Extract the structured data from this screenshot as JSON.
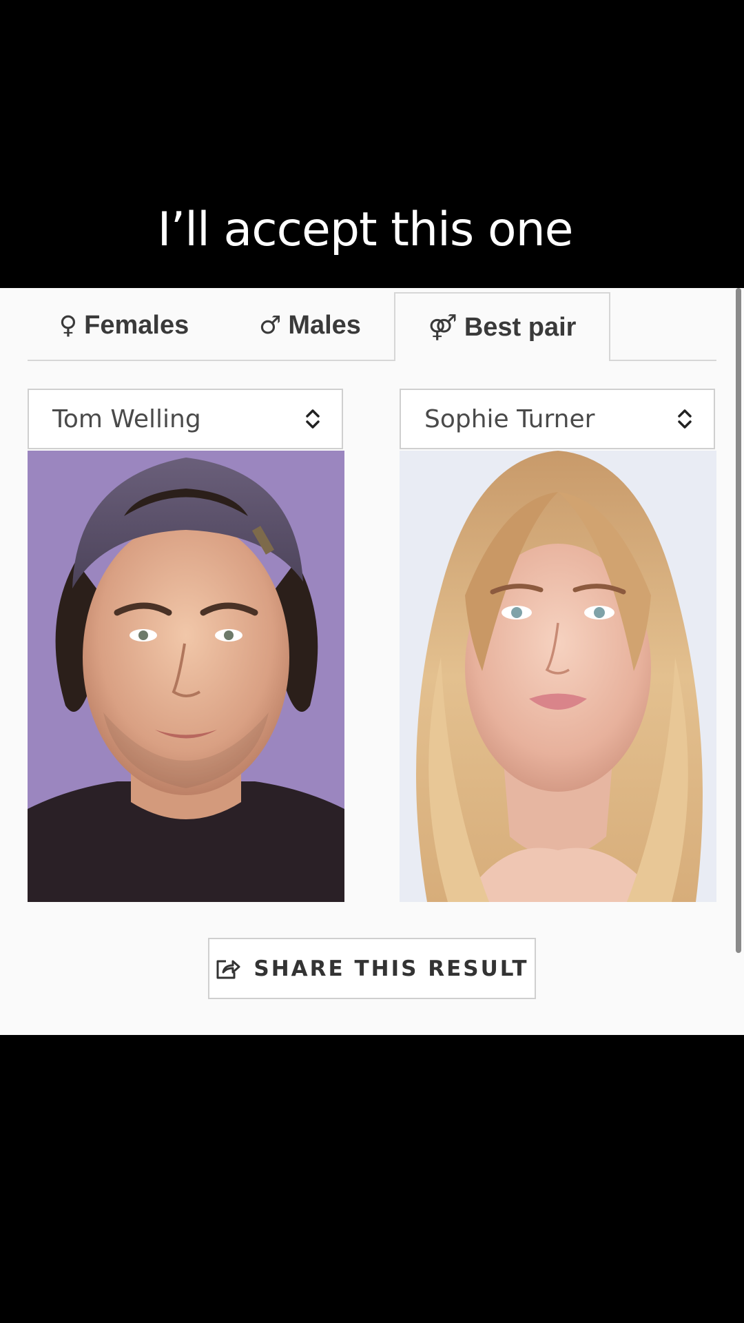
{
  "caption": "I’ll accept this one",
  "tabs": [
    {
      "glyph": "♀",
      "label": "Females",
      "icon": "female-symbol-icon"
    },
    {
      "glyph": "♂",
      "label": "Males",
      "icon": "male-symbol-icon"
    },
    {
      "glyph": "⚤",
      "label": "Best pair",
      "icon": "pair-symbol-icon",
      "active": true
    }
  ],
  "left_select": {
    "value": "Tom Welling"
  },
  "right_select": {
    "value": "Sophie Turner"
  },
  "share": {
    "label": "SHARE THIS RESULT",
    "icon": "share-icon"
  },
  "colors": {
    "left_photo_bg": "#9b86bf",
    "right_photo_bg": "#e9ecf4",
    "panel_bg": "#fafafa"
  }
}
